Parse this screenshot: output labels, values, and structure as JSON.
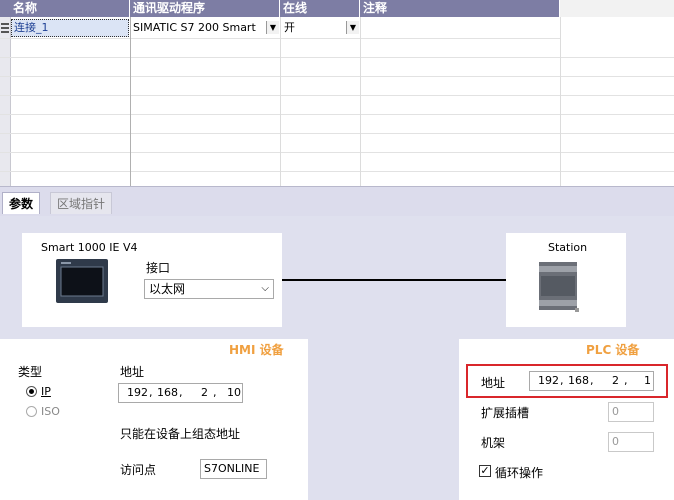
{
  "table": {
    "headers": [
      "名称",
      "通讯驱动程序",
      "在线",
      "注释"
    ],
    "rows": [
      {
        "name": "连接_1",
        "driver": "SIMATIC S7 200 Smart",
        "online": "开",
        "comment": ""
      }
    ]
  },
  "tabs": [
    {
      "label": "参数",
      "active": true
    },
    {
      "label": "区域指针",
      "active": false
    }
  ],
  "hmi_box": {
    "device_name": "Smart 1000 IE V4",
    "interface_label": "接口",
    "interface_value": "以太网"
  },
  "plc_box": {
    "station_label": "Station"
  },
  "hmi_device": {
    "section_title": "HMI 设备",
    "type_label": "类型",
    "type_options": [
      "IP",
      "ISO"
    ],
    "type_selected": "IP",
    "address_label": "地址",
    "address": [
      "192",
      "168",
      "2",
      "10"
    ],
    "note": "只能在设备上组态地址",
    "access_point_label": "访问点",
    "access_point_value": "S7ONLINE"
  },
  "plc_device": {
    "section_title": "PLC 设备",
    "address_label": "地址",
    "address": [
      "192",
      "168",
      "2",
      "1"
    ],
    "expansion_slot_label": "扩展插槽",
    "expansion_slot_value": "0",
    "rack_label": "机架",
    "rack_value": "0",
    "cyclic_label": "循环操作",
    "cyclic_checked": true
  },
  "colors": {
    "header_bg": "#7d7da4",
    "panel_bg": "#dfe0ee",
    "section_title": "#f0a040",
    "highlight_border": "#d9262b"
  }
}
